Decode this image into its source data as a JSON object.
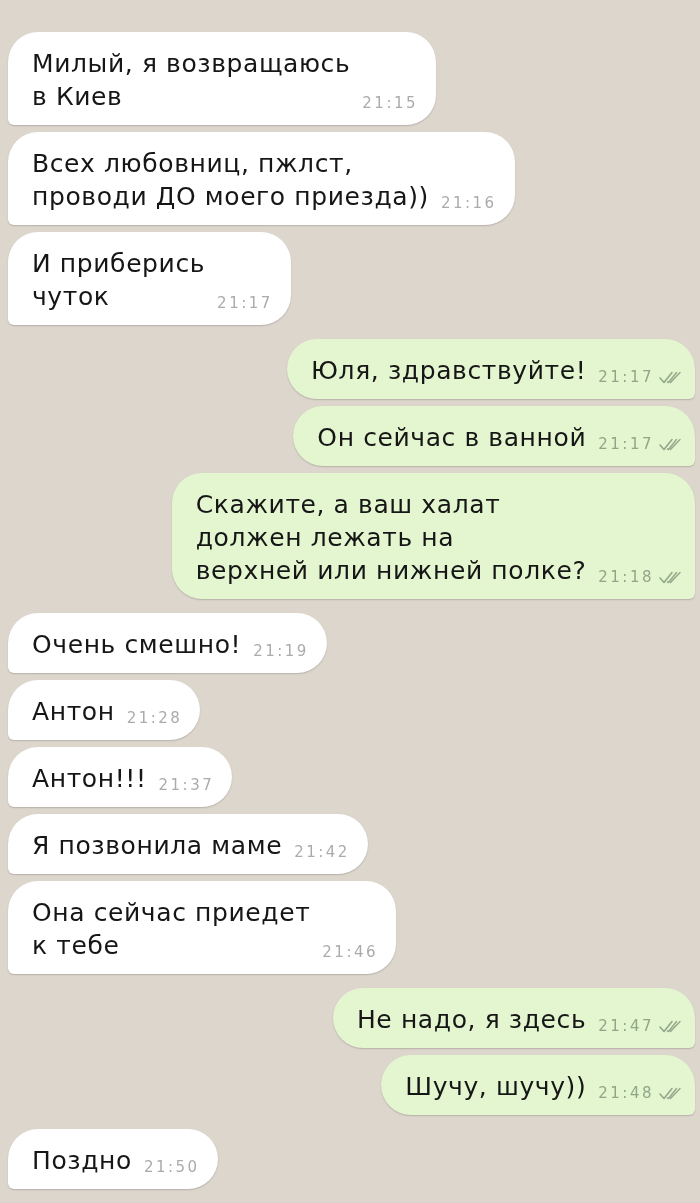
{
  "messages": [
    {
      "kind": "incoming",
      "lines": [
        "Милый, я возвращаюсь",
        "в Киев"
      ],
      "time": "21:15"
    },
    {
      "kind": "incoming",
      "lines": [
        "Всех любовниц, пжлст,",
        "проводи ДО моего приезда))"
      ],
      "time": "21:16"
    },
    {
      "kind": "incoming",
      "lines": [
        "И приберись",
        "чуток"
      ],
      "time": "21:17"
    },
    {
      "kind": "outgoing",
      "lines": [
        "Юля, здравствуйте!"
      ],
      "time": "21:17",
      "read": false
    },
    {
      "kind": "outgoing",
      "lines": [
        "Он сейчас в ванной"
      ],
      "time": "21:17",
      "read": false
    },
    {
      "kind": "outgoing",
      "lines": [
        "Скажите, а ваш халат",
        "должен лежать на",
        "верхней или нижней полке?"
      ],
      "time": "21:18",
      "read": false
    },
    {
      "kind": "incoming",
      "lines": [
        "Очень смешно!"
      ],
      "time": "21:19"
    },
    {
      "kind": "incoming",
      "lines": [
        "Антон"
      ],
      "time": "21:28"
    },
    {
      "kind": "incoming",
      "lines": [
        "Антон!!!"
      ],
      "time": "21:37"
    },
    {
      "kind": "incoming",
      "lines": [
        "Я позвонила маме"
      ],
      "time": "21:42"
    },
    {
      "kind": "incoming",
      "lines": [
        "Она сейчас приедет",
        "к тебе"
      ],
      "time": "21:46"
    },
    {
      "kind": "outgoing",
      "lines": [
        "Не надо, я здесь"
      ],
      "time": "21:47",
      "read": false
    },
    {
      "kind": "outgoing",
      "lines": [
        "Шучу, шучу))"
      ],
      "time": "21:48",
      "read": false
    },
    {
      "kind": "incoming",
      "lines": [
        "Поздно"
      ],
      "time": "21:50"
    }
  ]
}
